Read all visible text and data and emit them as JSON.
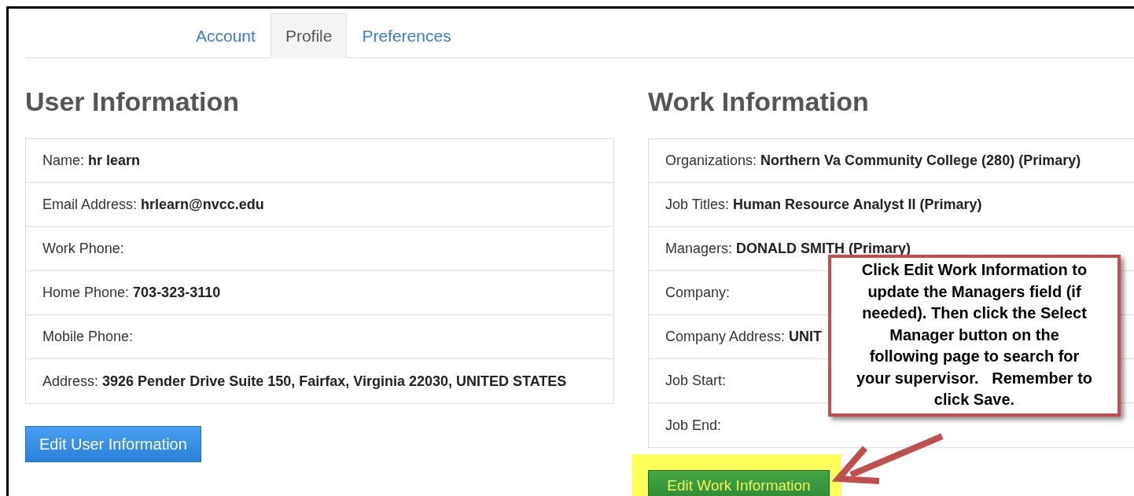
{
  "tabs": [
    {
      "label": "Account",
      "selected": false
    },
    {
      "label": "Profile",
      "selected": true
    },
    {
      "label": "Preferences",
      "selected": false
    }
  ],
  "user_information": {
    "heading": "User Information",
    "rows": [
      {
        "label": "Name:",
        "value": "hr learn"
      },
      {
        "label": "Email Address:",
        "value": "hrlearn@nvcc.edu"
      },
      {
        "label": "Work Phone:"
      },
      {
        "label": "Home Phone:",
        "value": "703-323-3110"
      },
      {
        "label": "Mobile Phone:"
      },
      {
        "label": "Address:",
        "value": "3926 Pender Drive Suite 150, Fairfax, Virginia 22030, UNITED STATES"
      }
    ],
    "button": "Edit User Information"
  },
  "work_information": {
    "heading": "Work Information",
    "rows": [
      {
        "label": "Organizations:",
        "value": "Northern Va Community College (280) (Primary)"
      },
      {
        "label": "Job Titles:",
        "value": "Human Resource Analyst II (Primary)"
      },
      {
        "label": "Managers:",
        "value": "DONALD SMITH (Primary)"
      },
      {
        "label": "Company:"
      },
      {
        "label": "Company Address:",
        "value": "UNIT"
      },
      {
        "label": "Job Start:"
      },
      {
        "label": "Job End:"
      }
    ],
    "button": "Edit Work Information"
  },
  "callout": {
    "text": "Click Edit Work Information to\nupdate the Managers field (if\nneeded). Then click the Select\nManager button on the\nfollowing page to search for\nyour supervisor.   Remember to\nclick Save."
  }
}
